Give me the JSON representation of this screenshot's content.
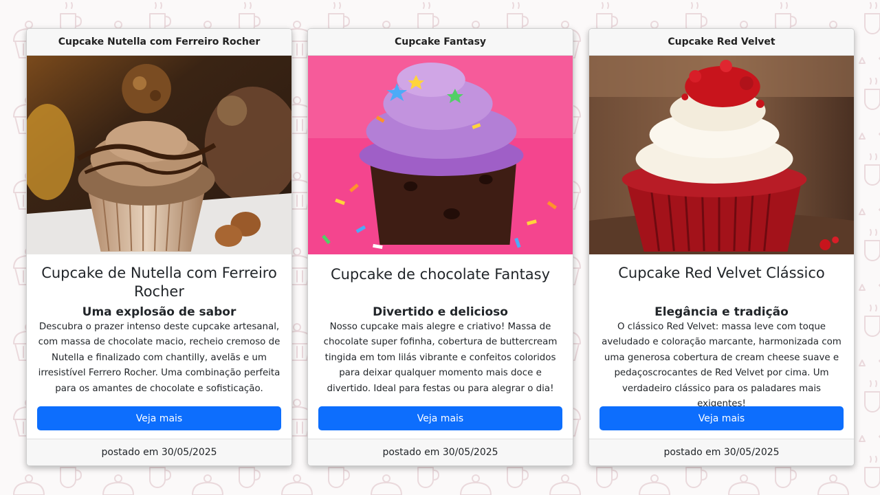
{
  "cards": [
    {
      "header": "Cupcake Nutella com Ferreiro Rocher",
      "image_alt": "cupcake-nutella-ferrero-image",
      "title": "Cupcake de Nutella com Ferreiro Rocher",
      "subtitle": "Uma explosão de sabor",
      "text": "Descubra o prazer intenso deste cupcake artesanal, com massa de chocolate macio, recheio cremoso de Nutella e finalizado com chantilly, avelãs e um irresistível Ferrero Rocher. Uma combinação perfeita para os amantes de chocolate e sofisticação.",
      "button": "Veja mais",
      "footer": "postado em 30/05/2025"
    },
    {
      "header": "Cupcake Fantasy",
      "image_alt": "cupcake-fantasy-image",
      "title": "Cupcake de chocolate Fantasy",
      "subtitle": "Divertido e delicioso",
      "text": "Nosso cupcake mais alegre e criativo! Massa de chocolate super fofinha, cobertura de buttercream tingida em tom lilás vibrante e confeitos coloridos para deixar qualquer momento mais doce e divertido. Ideal para festas ou para alegrar o dia!",
      "button": "Veja mais",
      "footer": "postado em 30/05/2025"
    },
    {
      "header": "Cupcake Red Velvet",
      "image_alt": "cupcake-red-velvet-image",
      "title": "Cupcake Red Velvet Clássico",
      "subtitle": "Elegância e tradição",
      "text": "O clássico Red Velvet: massa leve com toque aveludado e coloração marcante, harmonizada com uma generosa cobertura de cream cheese suave e pedaçoscrocantes de Red Velvet por cima. Um verdadeiro clássico para os paladares mais exigentes!",
      "button": "Veja mais",
      "footer": "postado em 30/05/2025"
    }
  ],
  "colors": {
    "primary_button": "#0d6efd",
    "page_background": "#fbf9f9",
    "pattern_stroke": "#ead9dc"
  }
}
